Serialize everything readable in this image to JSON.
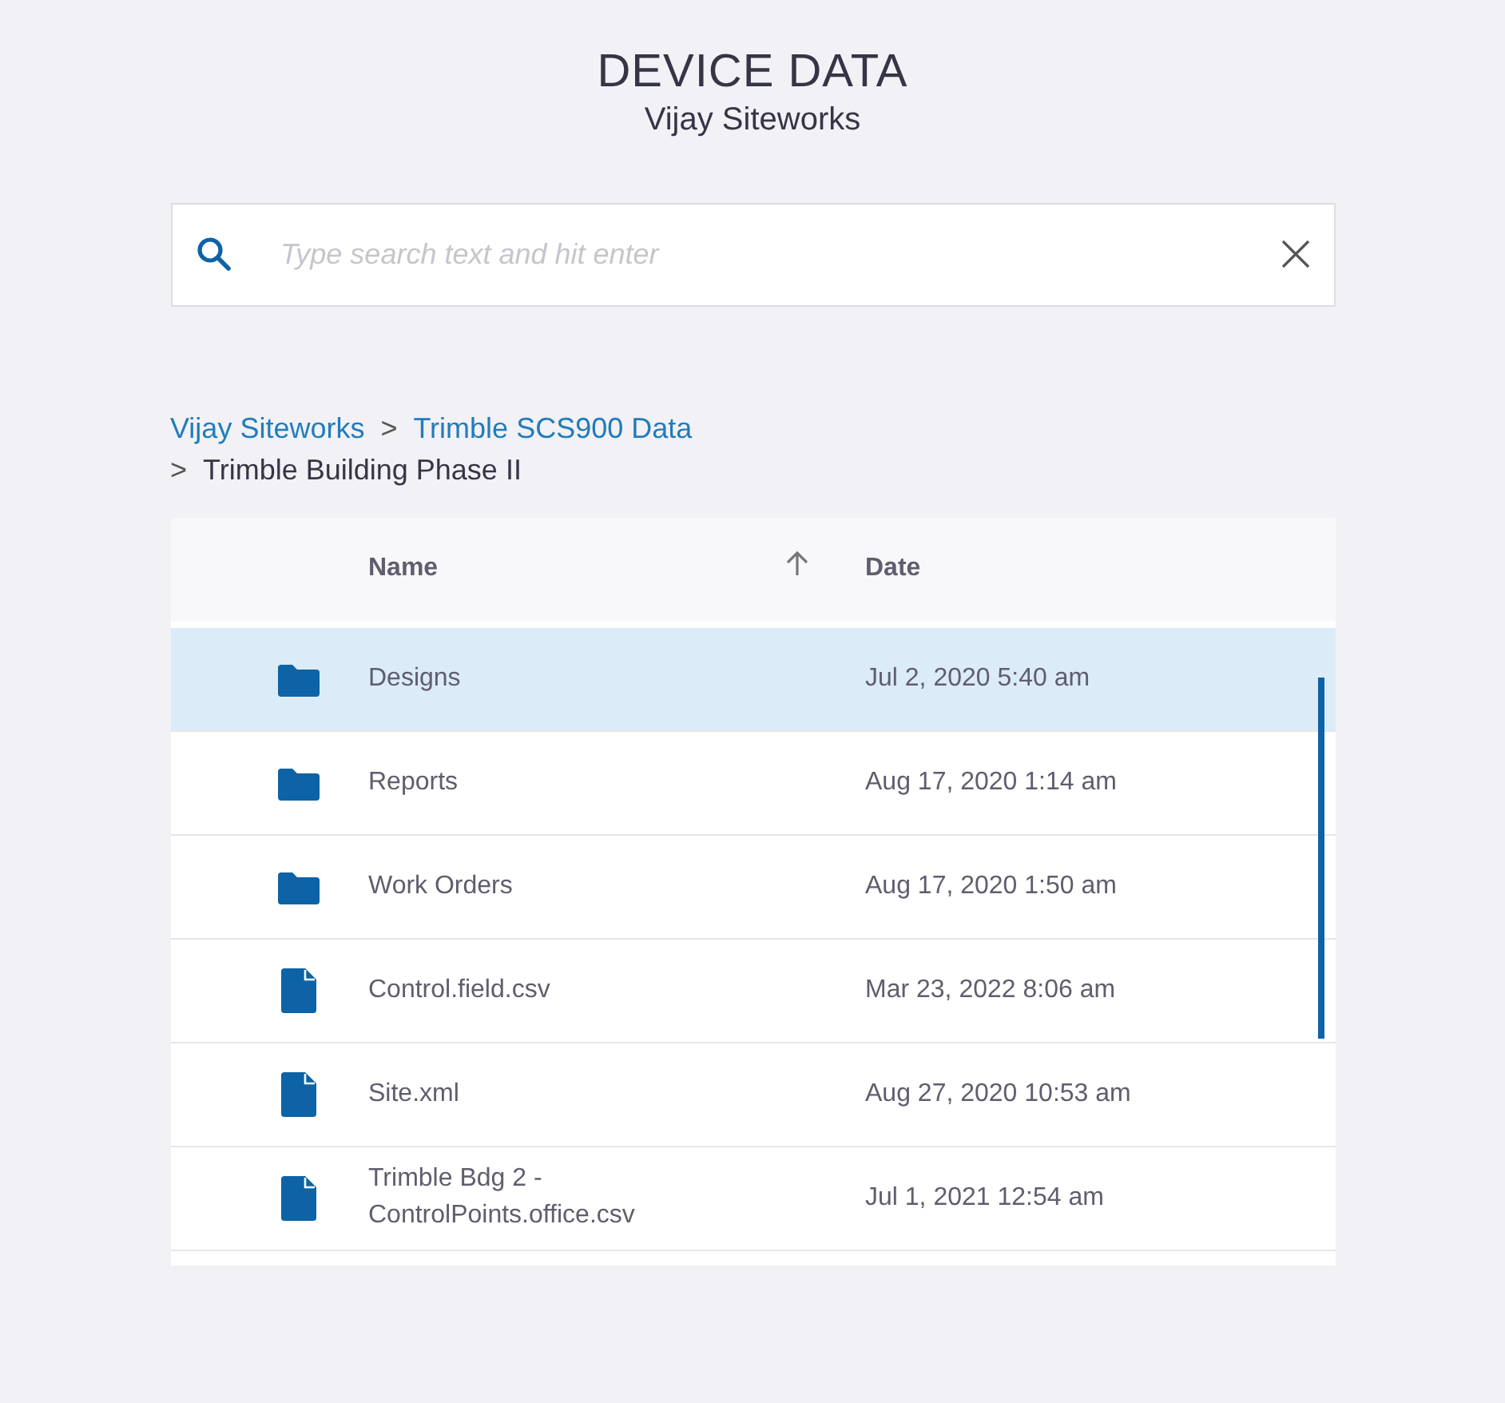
{
  "header": {
    "title": "DEVICE DATA",
    "subtitle": "Vijay Siteworks"
  },
  "search": {
    "placeholder": "Type search text and hit enter"
  },
  "breadcrumbs": [
    {
      "label": "Vijay Siteworks",
      "current": false
    },
    {
      "separator": ">",
      "label": "Trimble SCS900 Data",
      "current": false
    },
    {
      "separator": ">",
      "label": "Trimble Building Phase II",
      "current": true
    }
  ],
  "table": {
    "columns": [
      {
        "label": "Name",
        "sort_ascending": true
      },
      {
        "label": "Date"
      }
    ],
    "rows": [
      {
        "kind": "folder",
        "name": "Designs",
        "date": "Jul 2, 2020 5:40 am",
        "selected": true
      },
      {
        "kind": "folder",
        "name": "Reports",
        "date": "Aug 17, 2020 1:14 am",
        "selected": false
      },
      {
        "kind": "folder",
        "name": "Work Orders",
        "date": "Aug 17, 2020 1:50 am",
        "selected": false
      },
      {
        "kind": "file",
        "name": "Control.field.csv",
        "date": "Mar 23, 2022 8:06 am",
        "selected": false
      },
      {
        "kind": "file",
        "name": "Site.xml",
        "date": "Aug 27, 2020 10:53 am",
        "selected": false
      },
      {
        "kind": "file",
        "name": "Trimble Bdg 2 - ControlPoints.office.csv",
        "date": "Jul 1, 2021 12:54 am",
        "selected": false
      }
    ]
  }
}
